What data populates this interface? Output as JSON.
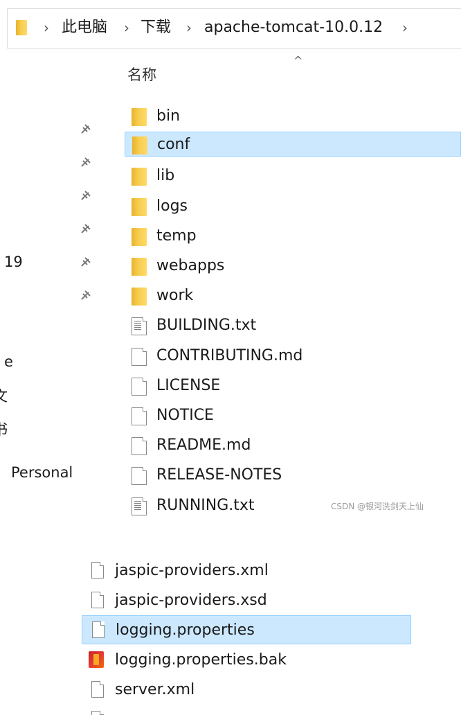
{
  "address_bar": {
    "crumbs": [
      "此电脑",
      "下载",
      "apache-tomcat-10.0.12"
    ]
  },
  "nav_pane": {
    "pinned_count": 6,
    "texts": [
      "19",
      "e",
      "文",
      "书",
      "Personal"
    ]
  },
  "file_list": {
    "column_header": "名称",
    "sort_indicator": "^",
    "items": [
      {
        "name": "bin",
        "type": "folder",
        "selected": false
      },
      {
        "name": "conf",
        "type": "folder",
        "selected": true
      },
      {
        "name": "lib",
        "type": "folder",
        "selected": false
      },
      {
        "name": "logs",
        "type": "folder",
        "selected": false
      },
      {
        "name": "temp",
        "type": "folder",
        "selected": false
      },
      {
        "name": "webapps",
        "type": "folder",
        "selected": false
      },
      {
        "name": "work",
        "type": "folder",
        "selected": false
      },
      {
        "name": "BUILDING.txt",
        "type": "text-file",
        "selected": false
      },
      {
        "name": "CONTRIBUTING.md",
        "type": "file",
        "selected": false
      },
      {
        "name": "LICENSE",
        "type": "file",
        "selected": false
      },
      {
        "name": "NOTICE",
        "type": "file",
        "selected": false
      },
      {
        "name": "README.md",
        "type": "file",
        "selected": false
      },
      {
        "name": "RELEASE-NOTES",
        "type": "file",
        "selected": false
      },
      {
        "name": "RUNNING.txt",
        "type": "text-file",
        "selected": false
      }
    ]
  },
  "watermark": "CSDN @银河洗剑天上仙",
  "lower_list": {
    "items": [
      {
        "name": "jaspic-providers.xml",
        "type": "file",
        "selected": false
      },
      {
        "name": "jaspic-providers.xsd",
        "type": "file",
        "selected": false
      },
      {
        "name": "logging.properties",
        "type": "file",
        "selected": true
      },
      {
        "name": "logging.properties.bak",
        "type": "bak-file",
        "selected": false
      },
      {
        "name": "server.xml",
        "type": "file",
        "selected": false
      }
    ]
  },
  "colors": {
    "selection_bg": "#cce8ff",
    "selection_border": "#99d1ff",
    "folder_yellow": "#f7cd50"
  }
}
